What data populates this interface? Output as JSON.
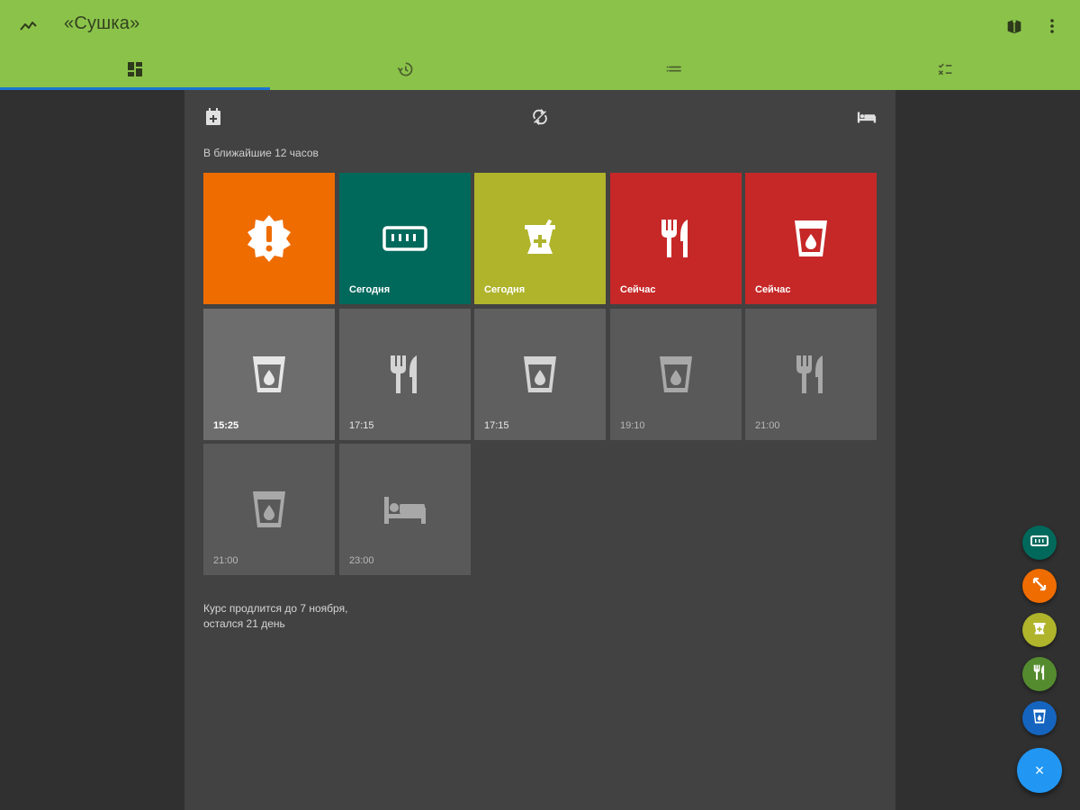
{
  "app": {
    "title": "«Сушка»",
    "accent_color": "#8bc34a",
    "toolbar_icons": [
      "trend-icon",
      "book-icon",
      "more-vert-icon"
    ]
  },
  "tabs": [
    {
      "icon": "dashboard-icon",
      "selected": true
    },
    {
      "icon": "history-icon",
      "selected": false
    },
    {
      "icon": "list-icon",
      "selected": false
    },
    {
      "icon": "rules-icon",
      "selected": false
    }
  ],
  "content": {
    "header_icons": [
      "calendar-add-icon",
      "sync-icon",
      "bed-icon"
    ],
    "section_label": "В ближайшие 12 часов",
    "course_line1": "Курс продлится до 7 ноября,",
    "course_line2": "остался 21 день"
  },
  "tiles": [
    {
      "icon": "alert-badge-icon",
      "label": "",
      "color": "#ef6c00"
    },
    {
      "icon": "ruler-icon",
      "label": "Сегодня",
      "color": "#00695c"
    },
    {
      "icon": "mortar-pestle-icon",
      "label": "Сегодня",
      "color": "#afb42b"
    },
    {
      "icon": "cutlery-icon",
      "label": "Сейчас",
      "color": "#c62828"
    },
    {
      "icon": "water-glass-icon",
      "label": "Сейчас",
      "color": "#c62828"
    },
    {
      "icon": "water-glass-icon",
      "label": "15:25",
      "color": "#6d6d6d"
    },
    {
      "icon": "cutlery-icon",
      "label": "17:15",
      "color": "#5f5f5f"
    },
    {
      "icon": "water-glass-icon",
      "label": "17:15",
      "color": "#5f5f5f"
    },
    {
      "icon": "water-glass-icon",
      "label": "19:10",
      "color": "#595959"
    },
    {
      "icon": "cutlery-icon",
      "label": "21:00",
      "color": "#595959"
    },
    {
      "icon": "water-glass-icon",
      "label": "21:00",
      "color": "#595959"
    },
    {
      "icon": "bed-icon",
      "label": "23:00",
      "color": "#595959"
    }
  ],
  "speed_dial": [
    {
      "icon": "ruler-icon",
      "color": "#00695c"
    },
    {
      "icon": "resize-icon",
      "color": "#ef6c00"
    },
    {
      "icon": "mortar-pestle-icon",
      "color": "#afb42b"
    },
    {
      "icon": "cutlery-icon",
      "color": "#558b2f"
    },
    {
      "icon": "water-glass-icon",
      "color": "#1565c0"
    }
  ],
  "fab": {
    "label": "×",
    "color": "#2196f3"
  }
}
